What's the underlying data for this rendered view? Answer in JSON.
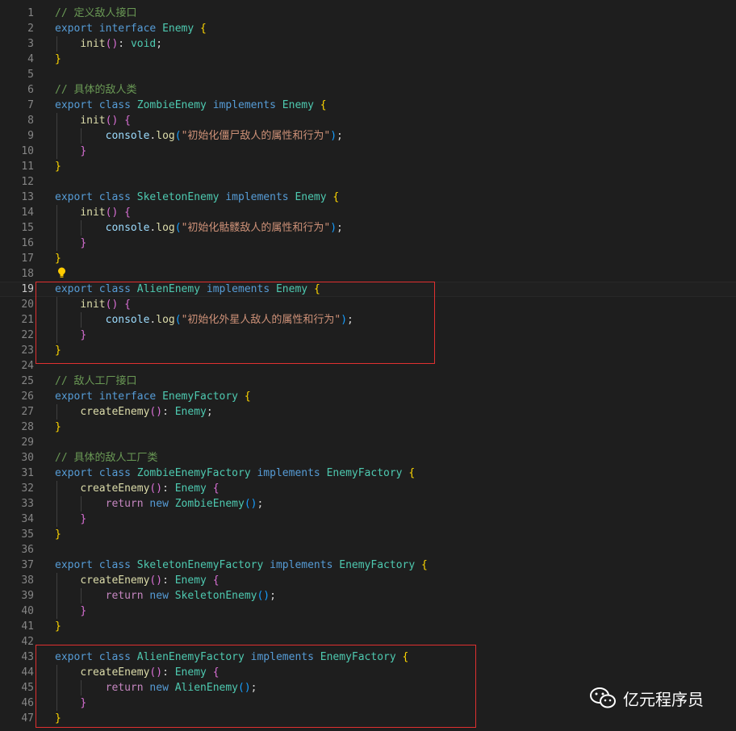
{
  "colors": {
    "background": "#1e1e1e",
    "comment": "#6a9955",
    "keyword": "#569cd6",
    "control": "#c586c0",
    "type": "#4ec9b0",
    "function": "#dcdcaa",
    "variable": "#9cdcfe",
    "string": "#ce9178",
    "plain": "#d4d4d4",
    "bracket1": "#ffd700",
    "bracket2": "#da70d6",
    "bracket3": "#179fff",
    "highlight_box": "#e03030"
  },
  "editor": {
    "current_line": 19,
    "lightbulb_icon": "lightbulb-icon",
    "lightbulb_line": 18,
    "highlight_boxes": [
      {
        "from_line": 19,
        "to_line": 23
      },
      {
        "from_line": 43,
        "to_line": 47
      }
    ],
    "lines": [
      {
        "n": "1",
        "indent": 0,
        "tokens": [
          [
            "comment",
            "// 定义敌人接口"
          ]
        ]
      },
      {
        "n": "2",
        "indent": 0,
        "tokens": [
          [
            "keyword",
            "export"
          ],
          [
            "plain",
            " "
          ],
          [
            "keyword",
            "interface"
          ],
          [
            "plain",
            " "
          ],
          [
            "type",
            "Enemy"
          ],
          [
            "plain",
            " "
          ],
          [
            "bracket1",
            "{"
          ]
        ]
      },
      {
        "n": "3",
        "indent": 1,
        "tokens": [
          [
            "plain",
            "    "
          ],
          [
            "function",
            "init"
          ],
          [
            "bracket2",
            "()"
          ],
          [
            "plain",
            ": "
          ],
          [
            "type",
            "void"
          ],
          [
            "plain",
            ";"
          ]
        ]
      },
      {
        "n": "4",
        "indent": 0,
        "tokens": [
          [
            "bracket1",
            "}"
          ]
        ]
      },
      {
        "n": "5",
        "indent": 0,
        "tokens": []
      },
      {
        "n": "6",
        "indent": 0,
        "tokens": [
          [
            "comment",
            "// 具体的敌人类"
          ]
        ]
      },
      {
        "n": "7",
        "indent": 0,
        "tokens": [
          [
            "keyword",
            "export"
          ],
          [
            "plain",
            " "
          ],
          [
            "keyword",
            "class"
          ],
          [
            "plain",
            " "
          ],
          [
            "type",
            "ZombieEnemy"
          ],
          [
            "plain",
            " "
          ],
          [
            "keyword",
            "implements"
          ],
          [
            "plain",
            " "
          ],
          [
            "type",
            "Enemy"
          ],
          [
            "plain",
            " "
          ],
          [
            "bracket1",
            "{"
          ]
        ]
      },
      {
        "n": "8",
        "indent": 1,
        "tokens": [
          [
            "plain",
            "    "
          ],
          [
            "function",
            "init"
          ],
          [
            "bracket2",
            "()"
          ],
          [
            "plain",
            " "
          ],
          [
            "bracket2",
            "{"
          ]
        ]
      },
      {
        "n": "9",
        "indent": 2,
        "tokens": [
          [
            "plain",
            "        "
          ],
          [
            "var",
            "console"
          ],
          [
            "plain",
            "."
          ],
          [
            "function",
            "log"
          ],
          [
            "bracket3",
            "("
          ],
          [
            "string",
            "\"初始化僵尸敌人的属性和行为\""
          ],
          [
            "bracket3",
            ")"
          ],
          [
            "plain",
            ";"
          ]
        ]
      },
      {
        "n": "10",
        "indent": 1,
        "tokens": [
          [
            "plain",
            "    "
          ],
          [
            "bracket2",
            "}"
          ]
        ]
      },
      {
        "n": "11",
        "indent": 0,
        "tokens": [
          [
            "bracket1",
            "}"
          ]
        ]
      },
      {
        "n": "12",
        "indent": 0,
        "tokens": []
      },
      {
        "n": "13",
        "indent": 0,
        "tokens": [
          [
            "keyword",
            "export"
          ],
          [
            "plain",
            " "
          ],
          [
            "keyword",
            "class"
          ],
          [
            "plain",
            " "
          ],
          [
            "type",
            "SkeletonEnemy"
          ],
          [
            "plain",
            " "
          ],
          [
            "keyword",
            "implements"
          ],
          [
            "plain",
            " "
          ],
          [
            "type",
            "Enemy"
          ],
          [
            "plain",
            " "
          ],
          [
            "bracket1",
            "{"
          ]
        ]
      },
      {
        "n": "14",
        "indent": 1,
        "tokens": [
          [
            "plain",
            "    "
          ],
          [
            "function",
            "init"
          ],
          [
            "bracket2",
            "()"
          ],
          [
            "plain",
            " "
          ],
          [
            "bracket2",
            "{"
          ]
        ]
      },
      {
        "n": "15",
        "indent": 2,
        "tokens": [
          [
            "plain",
            "        "
          ],
          [
            "var",
            "console"
          ],
          [
            "plain",
            "."
          ],
          [
            "function",
            "log"
          ],
          [
            "bracket3",
            "("
          ],
          [
            "string",
            "\"初始化骷髅敌人的属性和行为\""
          ],
          [
            "bracket3",
            ")"
          ],
          [
            "plain",
            ";"
          ]
        ]
      },
      {
        "n": "16",
        "indent": 1,
        "tokens": [
          [
            "plain",
            "    "
          ],
          [
            "bracket2",
            "}"
          ]
        ]
      },
      {
        "n": "17",
        "indent": 0,
        "tokens": [
          [
            "bracket1",
            "}"
          ]
        ]
      },
      {
        "n": "18",
        "indent": 0,
        "tokens": []
      },
      {
        "n": "19",
        "indent": 0,
        "tokens": [
          [
            "keyword",
            "export"
          ],
          [
            "plain",
            " "
          ],
          [
            "keyword",
            "class"
          ],
          [
            "plain",
            " "
          ],
          [
            "type",
            "AlienEnemy"
          ],
          [
            "plain",
            " "
          ],
          [
            "keyword",
            "implements"
          ],
          [
            "plain",
            " "
          ],
          [
            "type",
            "Enemy"
          ],
          [
            "plain",
            " "
          ],
          [
            "bracket1",
            "{"
          ]
        ]
      },
      {
        "n": "20",
        "indent": 1,
        "tokens": [
          [
            "plain",
            "    "
          ],
          [
            "function",
            "init"
          ],
          [
            "bracket2",
            "()"
          ],
          [
            "plain",
            " "
          ],
          [
            "bracket2",
            "{"
          ]
        ]
      },
      {
        "n": "21",
        "indent": 2,
        "tokens": [
          [
            "plain",
            "        "
          ],
          [
            "var",
            "console"
          ],
          [
            "plain",
            "."
          ],
          [
            "function",
            "log"
          ],
          [
            "bracket3",
            "("
          ],
          [
            "string",
            "\"初始化外星人敌人的属性和行为\""
          ],
          [
            "bracket3",
            ")"
          ],
          [
            "plain",
            ";"
          ]
        ]
      },
      {
        "n": "22",
        "indent": 1,
        "tokens": [
          [
            "plain",
            "    "
          ],
          [
            "bracket2",
            "}"
          ]
        ]
      },
      {
        "n": "23",
        "indent": 0,
        "tokens": [
          [
            "bracket1",
            "}"
          ]
        ]
      },
      {
        "n": "24",
        "indent": 0,
        "tokens": []
      },
      {
        "n": "25",
        "indent": 0,
        "tokens": [
          [
            "comment",
            "// 敌人工厂接口"
          ]
        ]
      },
      {
        "n": "26",
        "indent": 0,
        "tokens": [
          [
            "keyword",
            "export"
          ],
          [
            "plain",
            " "
          ],
          [
            "keyword",
            "interface"
          ],
          [
            "plain",
            " "
          ],
          [
            "type",
            "EnemyFactory"
          ],
          [
            "plain",
            " "
          ],
          [
            "bracket1",
            "{"
          ]
        ]
      },
      {
        "n": "27",
        "indent": 1,
        "tokens": [
          [
            "plain",
            "    "
          ],
          [
            "function",
            "createEnemy"
          ],
          [
            "bracket2",
            "()"
          ],
          [
            "plain",
            ": "
          ],
          [
            "type",
            "Enemy"
          ],
          [
            "plain",
            ";"
          ]
        ]
      },
      {
        "n": "28",
        "indent": 0,
        "tokens": [
          [
            "bracket1",
            "}"
          ]
        ]
      },
      {
        "n": "29",
        "indent": 0,
        "tokens": []
      },
      {
        "n": "30",
        "indent": 0,
        "tokens": [
          [
            "comment",
            "// 具体的敌人工厂类"
          ]
        ]
      },
      {
        "n": "31",
        "indent": 0,
        "tokens": [
          [
            "keyword",
            "export"
          ],
          [
            "plain",
            " "
          ],
          [
            "keyword",
            "class"
          ],
          [
            "plain",
            " "
          ],
          [
            "type",
            "ZombieEnemyFactory"
          ],
          [
            "plain",
            " "
          ],
          [
            "keyword",
            "implements"
          ],
          [
            "plain",
            " "
          ],
          [
            "type",
            "EnemyFactory"
          ],
          [
            "plain",
            " "
          ],
          [
            "bracket1",
            "{"
          ]
        ]
      },
      {
        "n": "32",
        "indent": 1,
        "tokens": [
          [
            "plain",
            "    "
          ],
          [
            "function",
            "createEnemy"
          ],
          [
            "bracket2",
            "()"
          ],
          [
            "plain",
            ": "
          ],
          [
            "type",
            "Enemy"
          ],
          [
            "plain",
            " "
          ],
          [
            "bracket2",
            "{"
          ]
        ]
      },
      {
        "n": "33",
        "indent": 2,
        "tokens": [
          [
            "plain",
            "        "
          ],
          [
            "control",
            "return"
          ],
          [
            "plain",
            " "
          ],
          [
            "keyword",
            "new"
          ],
          [
            "plain",
            " "
          ],
          [
            "type",
            "ZombieEnemy"
          ],
          [
            "bracket3",
            "()"
          ],
          [
            "plain",
            ";"
          ]
        ]
      },
      {
        "n": "34",
        "indent": 1,
        "tokens": [
          [
            "plain",
            "    "
          ],
          [
            "bracket2",
            "}"
          ]
        ]
      },
      {
        "n": "35",
        "indent": 0,
        "tokens": [
          [
            "bracket1",
            "}"
          ]
        ]
      },
      {
        "n": "36",
        "indent": 0,
        "tokens": []
      },
      {
        "n": "37",
        "indent": 0,
        "tokens": [
          [
            "keyword",
            "export"
          ],
          [
            "plain",
            " "
          ],
          [
            "keyword",
            "class"
          ],
          [
            "plain",
            " "
          ],
          [
            "type",
            "SkeletonEnemyFactory"
          ],
          [
            "plain",
            " "
          ],
          [
            "keyword",
            "implements"
          ],
          [
            "plain",
            " "
          ],
          [
            "type",
            "EnemyFactory"
          ],
          [
            "plain",
            " "
          ],
          [
            "bracket1",
            "{"
          ]
        ]
      },
      {
        "n": "38",
        "indent": 1,
        "tokens": [
          [
            "plain",
            "    "
          ],
          [
            "function",
            "createEnemy"
          ],
          [
            "bracket2",
            "()"
          ],
          [
            "plain",
            ": "
          ],
          [
            "type",
            "Enemy"
          ],
          [
            "plain",
            " "
          ],
          [
            "bracket2",
            "{"
          ]
        ]
      },
      {
        "n": "39",
        "indent": 2,
        "tokens": [
          [
            "plain",
            "        "
          ],
          [
            "control",
            "return"
          ],
          [
            "plain",
            " "
          ],
          [
            "keyword",
            "new"
          ],
          [
            "plain",
            " "
          ],
          [
            "type",
            "SkeletonEnemy"
          ],
          [
            "bracket3",
            "()"
          ],
          [
            "plain",
            ";"
          ]
        ]
      },
      {
        "n": "40",
        "indent": 1,
        "tokens": [
          [
            "plain",
            "    "
          ],
          [
            "bracket2",
            "}"
          ]
        ]
      },
      {
        "n": "41",
        "indent": 0,
        "tokens": [
          [
            "bracket1",
            "}"
          ]
        ]
      },
      {
        "n": "42",
        "indent": 0,
        "tokens": []
      },
      {
        "n": "43",
        "indent": 0,
        "tokens": [
          [
            "keyword",
            "export"
          ],
          [
            "plain",
            " "
          ],
          [
            "keyword",
            "class"
          ],
          [
            "plain",
            " "
          ],
          [
            "type",
            "AlienEnemyFactory"
          ],
          [
            "plain",
            " "
          ],
          [
            "keyword",
            "implements"
          ],
          [
            "plain",
            " "
          ],
          [
            "type",
            "EnemyFactory"
          ],
          [
            "plain",
            " "
          ],
          [
            "bracket1",
            "{"
          ]
        ]
      },
      {
        "n": "44",
        "indent": 1,
        "tokens": [
          [
            "plain",
            "    "
          ],
          [
            "function",
            "createEnemy"
          ],
          [
            "bracket2",
            "()"
          ],
          [
            "plain",
            ": "
          ],
          [
            "type",
            "Enemy"
          ],
          [
            "plain",
            " "
          ],
          [
            "bracket2",
            "{"
          ]
        ]
      },
      {
        "n": "45",
        "indent": 2,
        "tokens": [
          [
            "plain",
            "        "
          ],
          [
            "control",
            "return"
          ],
          [
            "plain",
            " "
          ],
          [
            "keyword",
            "new"
          ],
          [
            "plain",
            " "
          ],
          [
            "type",
            "AlienEnemy"
          ],
          [
            "bracket3",
            "()"
          ],
          [
            "plain",
            ";"
          ]
        ]
      },
      {
        "n": "46",
        "indent": 1,
        "tokens": [
          [
            "plain",
            "    "
          ],
          [
            "bracket2",
            "}"
          ]
        ]
      },
      {
        "n": "47",
        "indent": 0,
        "tokens": [
          [
            "bracket1",
            "}"
          ]
        ]
      }
    ]
  },
  "watermark": {
    "icon": "wechat-icon",
    "text": "亿元程序员"
  }
}
